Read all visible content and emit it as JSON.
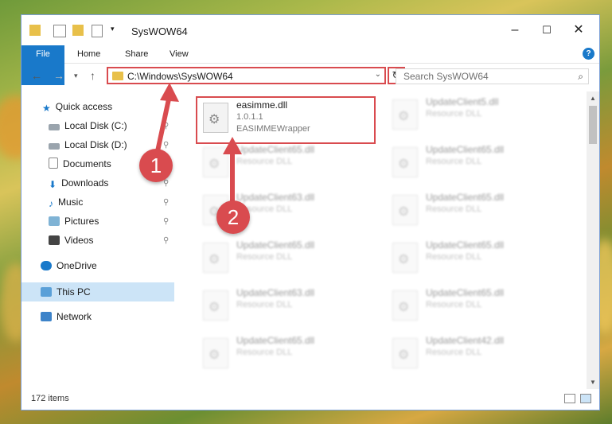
{
  "window": {
    "title": "SysWOW64"
  },
  "ribbon": {
    "tabs": [
      "File",
      "Home",
      "Share",
      "View"
    ],
    "help": "?"
  },
  "address": {
    "path": "C:\\Windows\\SysWOW64"
  },
  "search": {
    "placeholder": "Search SysWOW64"
  },
  "sidebar": {
    "items": [
      {
        "label": "Quick access",
        "icon": "star-icon"
      },
      {
        "label": "Local Disk (C:)",
        "icon": "drive-icon"
      },
      {
        "label": "Local Disk (D:)",
        "icon": "drive-icon"
      },
      {
        "label": "Documents",
        "icon": "documents-icon"
      },
      {
        "label": "Downloads",
        "icon": "download-icon"
      },
      {
        "label": "Music",
        "icon": "music-icon"
      },
      {
        "label": "Pictures",
        "icon": "pictures-icon"
      },
      {
        "label": "Videos",
        "icon": "videos-icon"
      },
      {
        "label": "OneDrive",
        "icon": "cloud-icon"
      },
      {
        "label": "This PC",
        "icon": "computer-icon"
      },
      {
        "label": "Network",
        "icon": "network-icon"
      }
    ]
  },
  "files": {
    "highlighted": {
      "name": "easimme.dll",
      "version": "1.0.1.1",
      "description": "EASIMMEWrapper"
    },
    "left_col": [
      {
        "name": "UpdateClient65.dll",
        "type": "Resource DLL"
      },
      {
        "name": "UpdateClient63.dll",
        "type": "Resource DLL"
      },
      {
        "name": "UpdateClient65.dll",
        "type": "Resource DLL"
      },
      {
        "name": "UpdateClient63.dll",
        "type": "Resource DLL"
      },
      {
        "name": "UpdateClient65.dll",
        "type": "Resource DLL"
      }
    ],
    "right_col": [
      {
        "name": "UpdateClient5.dll",
        "type": "Resource DLL"
      },
      {
        "name": "UpdateClient65.dll",
        "type": "Resource DLL"
      },
      {
        "name": "UpdateClient65.dll",
        "type": "Resource DLL"
      },
      {
        "name": "UpdateClient65.dll",
        "type": "Resource DLL"
      },
      {
        "name": "UpdateClient65.dll",
        "type": "Resource DLL"
      },
      {
        "name": "UpdateClient42.dll",
        "type": "Resource DLL"
      }
    ]
  },
  "status": {
    "items": "172 items"
  },
  "badges": [
    "1",
    "2"
  ],
  "colors": {
    "accent": "#1979ca",
    "annotation": "#d94b4f",
    "selection": "#cce4f7"
  }
}
